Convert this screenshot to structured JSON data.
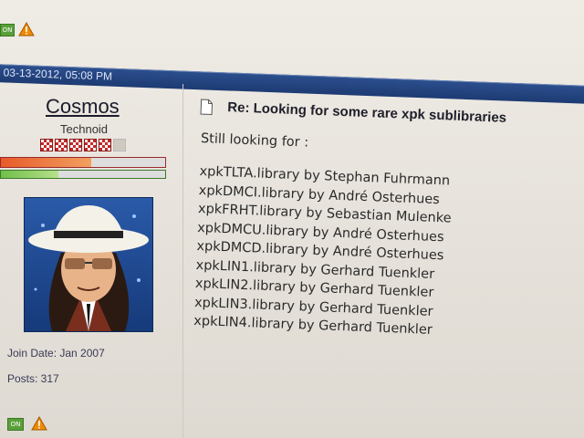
{
  "post": {
    "date": "03-13-2012, 05:08 PM",
    "title": "Re: Looking for some rare xpk sublibraries",
    "intro": "Still looking for :",
    "libraries": [
      "xpkTLTA.library by Stephan Fuhrmann",
      "xpkDMCI.library by André Osterhues",
      "xpkFRHT.library by Sebastian Mulenke",
      "xpkDMCU.library by André Osterhues",
      "xpkDMCD.library by André Osterhues",
      "xpkLIN1.library by Gerhard Tuenkler",
      "xpkLIN2.library by Gerhard Tuenkler",
      "xpkLIN3.library by Gerhard Tuenkler",
      "xpkLIN4.library by Gerhard Tuenkler"
    ]
  },
  "user": {
    "name": "Cosmos",
    "title": "Technoid",
    "join_date": "Join Date: Jan 2007",
    "posts": "Posts: 317",
    "reputation_filled": 5,
    "reputation_total": 6,
    "bar_level": 0.55,
    "bar2_level": 0.35
  },
  "badges": {
    "online_color": "#5aa03a",
    "warning_color": "#f08a00"
  }
}
